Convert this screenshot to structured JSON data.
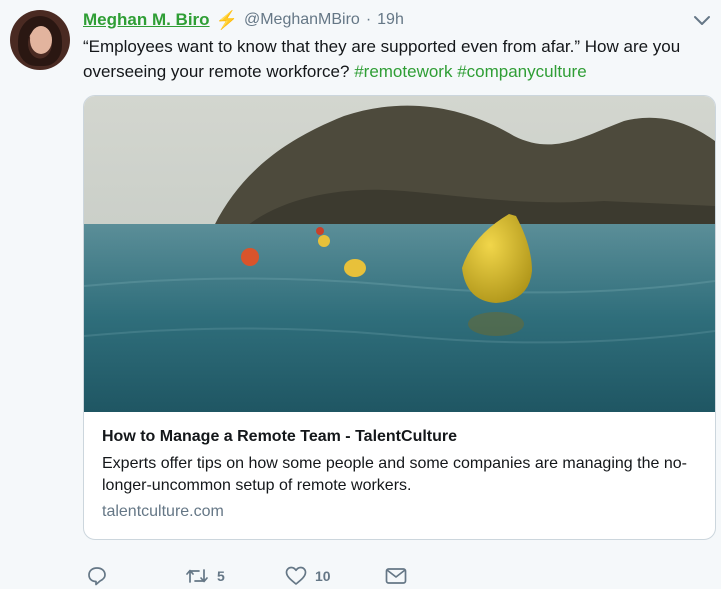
{
  "tweet": {
    "author_name": "Meghan M. Biro",
    "bolt_icon": "lightning-bolt-emoji",
    "handle": "@MeghanMBiro",
    "separator": "·",
    "timestamp": "19h",
    "text_main": "“Employees want to know that they are supported even from afar.” How are you overseeing your remote workforce?",
    "hashtags": [
      "#remotework",
      "#companyculture"
    ]
  },
  "card": {
    "title": "How to Manage a Remote Team - TalentCulture",
    "description": "Experts offer tips on how some people and some companies are managing the no-longer-uncommon setup of remote workers.",
    "domain": "talentculture.com"
  },
  "actions": {
    "reply_icon": "reply-icon",
    "retweet_icon": "retweet-icon",
    "retweet_count": "5",
    "like_icon": "heart-icon",
    "like_count": "10",
    "dm_icon": "envelope-icon"
  },
  "colors": {
    "accent_green": "#2f9e35",
    "muted": "#657786",
    "background": "#f5f8fa"
  }
}
